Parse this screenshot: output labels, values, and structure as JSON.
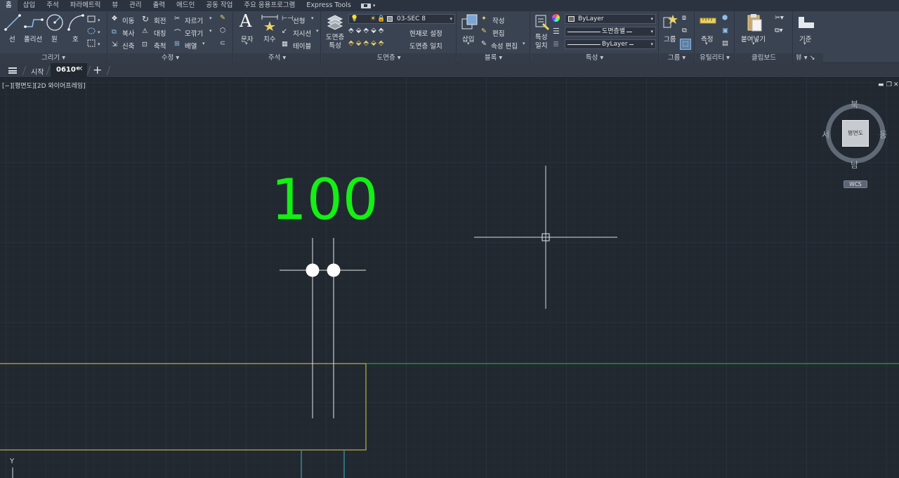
{
  "menu": {
    "tabs": [
      "홈",
      "삽입",
      "주석",
      "파라메트릭",
      "뷰",
      "관리",
      "출력",
      "애드인",
      "공동 작업",
      "주요 응용프로그램",
      "Express Tools"
    ],
    "active_tab": "홈"
  },
  "ribbon": {
    "draw": {
      "title": "그리기",
      "line": "선",
      "polyline": "폴리선",
      "circle": "원",
      "arc": "호"
    },
    "modify": {
      "title": "수정",
      "move": "이동",
      "rotate": "회전",
      "trim": "자르기",
      "copy": "복사",
      "mirror": "대칭",
      "fillet": "모깎기",
      "stretch": "신축",
      "scale": "축척",
      "array": "배열"
    },
    "annotation": {
      "title": "주석",
      "text": "문자",
      "dimension": "치수",
      "linear": "선형",
      "leader": "지시선",
      "table": "테이블"
    },
    "layers": {
      "title": "도면층",
      "properties": "도면층\n특성",
      "properties_line1": "도면층",
      "properties_line2": "특성",
      "current_layer": "03-SEC 8",
      "make_current": "현재로 설정",
      "match_layer": "도면층 일치"
    },
    "block": {
      "title": "블록",
      "insert": "삽입",
      "create": "작성",
      "edit": "편집",
      "edit_attributes": "속성 편집"
    },
    "properties": {
      "title": "특성",
      "match_line1": "특성",
      "match_line2": "일치",
      "color": "ByLayer",
      "lineweight": "도면층별",
      "linetype": "ByLayer"
    },
    "groups": {
      "title": "그룹",
      "group": "그룹"
    },
    "utilities": {
      "title": "유틸리티",
      "measure": "측정"
    },
    "clipboard": {
      "title": "클립보드",
      "paste": "붙여넣기"
    },
    "view": {
      "title": "뷰",
      "base": "기준"
    }
  },
  "doc_tabs": {
    "start": "시작",
    "active": "0610*"
  },
  "viewport": {
    "label": "[−][평면도][2D 와이어프레임]",
    "viewcube": {
      "face": "평면도",
      "north": "북",
      "south": "남",
      "east": "동",
      "west": "서",
      "wcs": "WCS"
    },
    "dimension_text": "100",
    "ucs_y": "Y"
  },
  "colors": {
    "background": "#212830",
    "dimension_text": "#14f014",
    "yellow_outline": "#d9d042",
    "green_line": "#15c83c",
    "cyan_line": "#3fb7c7"
  }
}
